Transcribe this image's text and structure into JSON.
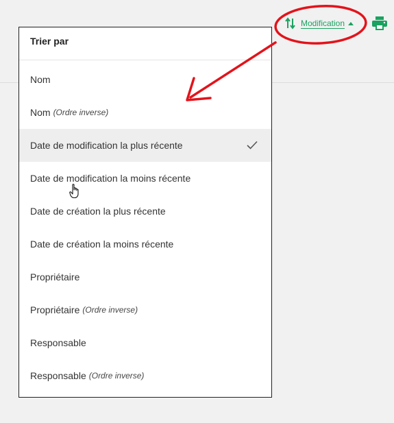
{
  "toolbar": {
    "sort_icon": "sort-arrows-icon",
    "sort_label": "Modification",
    "caret_icon": "caret-up-icon",
    "print_icon": "printer-icon",
    "accent_color": "#1aa260"
  },
  "dropdown": {
    "title": "Trier par",
    "check_icon": "checkmark-icon",
    "options": [
      {
        "label": "Nom",
        "note": ""
      },
      {
        "label": "Nom",
        "note": "(Ordre inverse)"
      },
      {
        "label": "Date de modification la plus récente",
        "note": "",
        "selected": true
      },
      {
        "label": "Date de modification la moins récente",
        "note": ""
      },
      {
        "label": "Date de création la plus récente",
        "note": ""
      },
      {
        "label": "Date de création la moins récente",
        "note": ""
      },
      {
        "label": "Propriétaire",
        "note": ""
      },
      {
        "label": "Propriétaire",
        "note": "(Ordre inverse)"
      },
      {
        "label": "Responsable",
        "note": ""
      },
      {
        "label": "Responsable",
        "note": "(Ordre inverse)"
      }
    ]
  },
  "annotation": {
    "color": "#e3131b",
    "shapes": [
      "ellipse-highlight",
      "arrow"
    ]
  }
}
